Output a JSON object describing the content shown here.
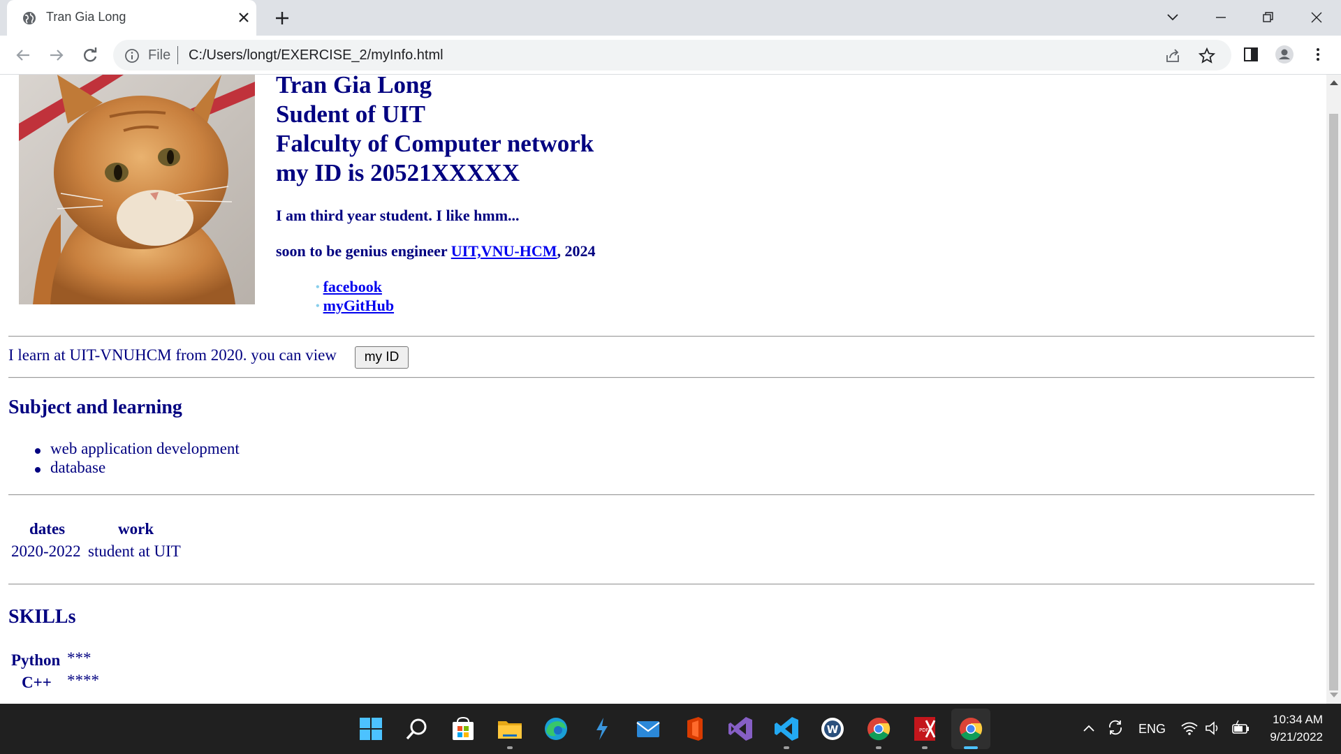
{
  "browser": {
    "tab_title": "Tran Gia Long",
    "address_scheme": "File",
    "address_url": "C:/Users/longt/EXERCISE_2/myInfo.html"
  },
  "page": {
    "header_lines": [
      "Tran Gia Long",
      "Sudent of UIT",
      "Falculty of Computer network",
      "my ID is 20521XXXXX"
    ],
    "intro": "I am third year student. I like hmm...",
    "genius_prefix": "soon to be genius engineer ",
    "genius_link": "UIT,VNU-HCM",
    "genius_suffix": ", 2024",
    "links": [
      "facebook",
      "myGitHub"
    ],
    "learn_text": "I learn at UIT-VNUHCM from 2020. you can view",
    "myid_button": "my ID",
    "subjects_heading": "Subject and learning",
    "subjects": [
      "web application development",
      "database"
    ],
    "table_headers": [
      "dates",
      "work"
    ],
    "table_row": [
      "2020-2022",
      "student at UIT"
    ],
    "skills_heading": "SKILLs",
    "skills": [
      {
        "name": "Python",
        "stars": "***"
      },
      {
        "name": "C++",
        "stars": "****"
      }
    ]
  },
  "taskbar": {
    "language": "ENG",
    "time": "10:34 AM",
    "date": "9/21/2022"
  },
  "colors": {
    "text": "#000080",
    "link": "#0000ee",
    "tabbar": "#dee1e6",
    "taskbar": "#202020"
  }
}
